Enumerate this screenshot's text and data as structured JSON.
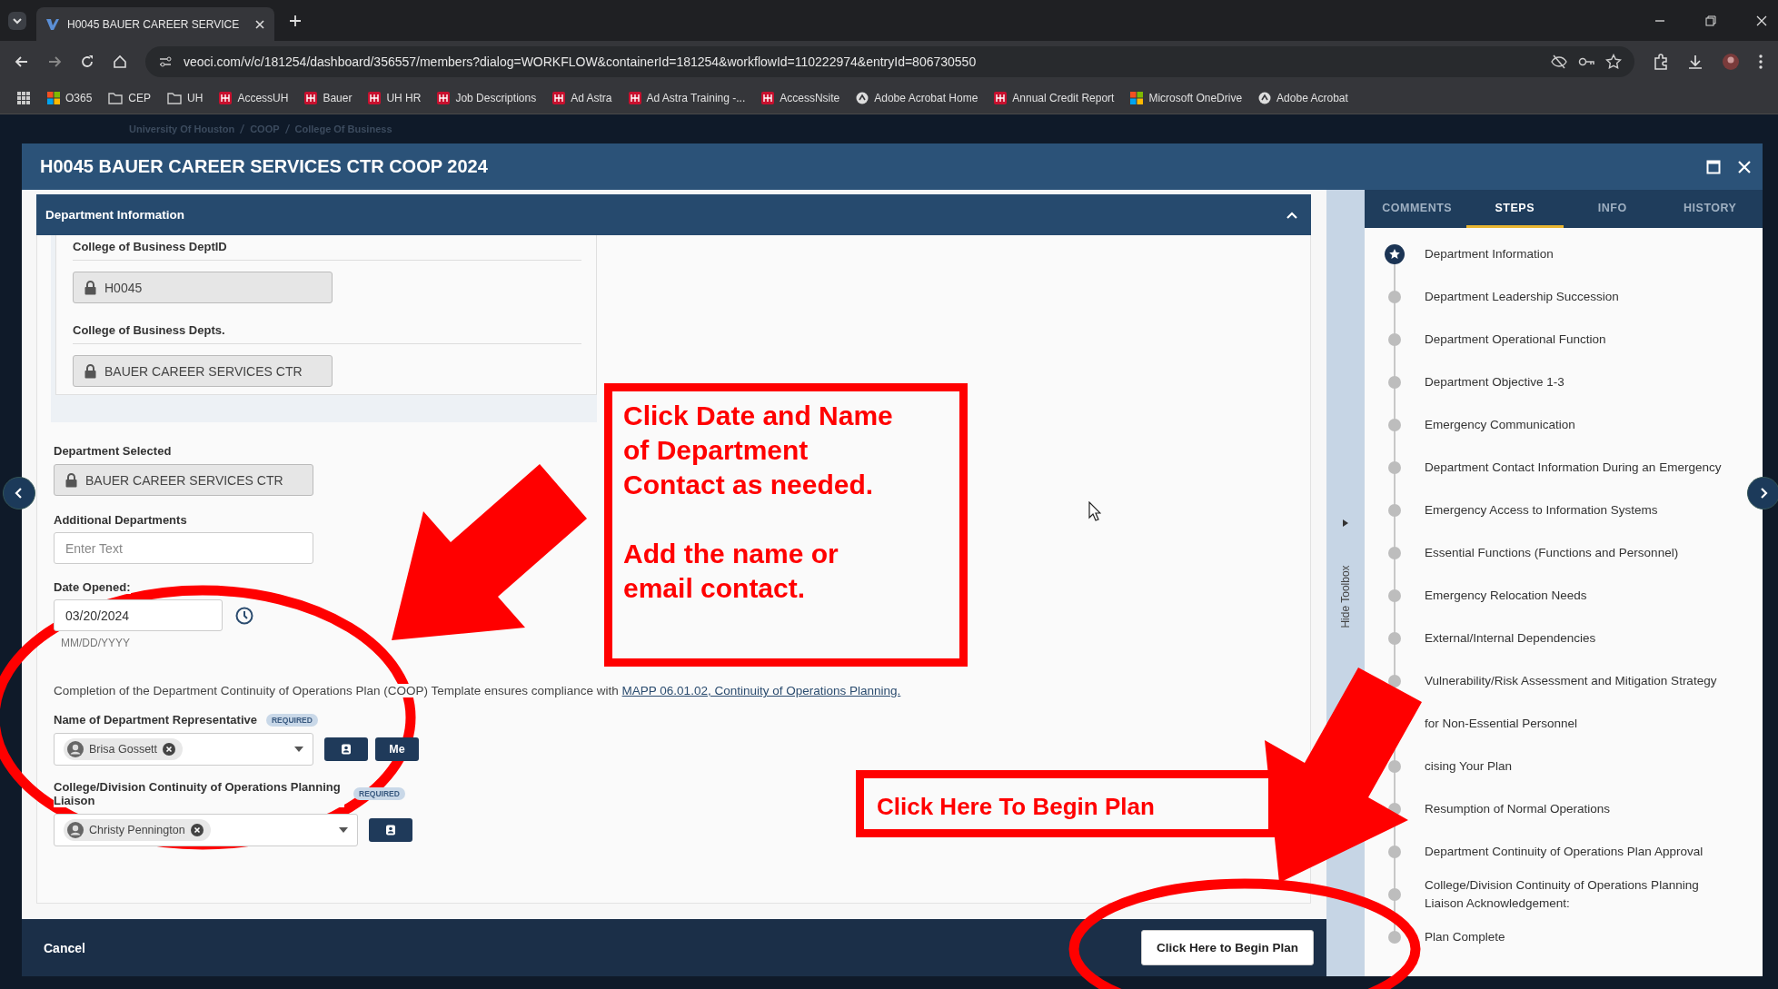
{
  "browser": {
    "tab_title": "H0045 BAUER CAREER SERVICE",
    "url": "veoci.com/v/c/181254/dashboard/356557/members?dialog=WORKFLOW&containerId=181254&workflowId=110222974&entryId=806730550",
    "bookmarks": [
      {
        "label": "O365",
        "kind": "tiles"
      },
      {
        "label": "CEP",
        "kind": "folder"
      },
      {
        "label": "UH",
        "kind": "folder"
      },
      {
        "label": "AccessUH",
        "kind": "logo"
      },
      {
        "label": "Bauer",
        "kind": "logo"
      },
      {
        "label": "UH HR",
        "kind": "logo"
      },
      {
        "label": "Job Descriptions",
        "kind": "logo"
      },
      {
        "label": "Ad Astra",
        "kind": "logo"
      },
      {
        "label": "Ad Astra Training -...",
        "kind": "logo"
      },
      {
        "label": "AccessNsite",
        "kind": "logo"
      },
      {
        "label": "Adobe Acrobat Home",
        "kind": "globe"
      },
      {
        "label": "Annual Credit Report",
        "kind": "logo"
      },
      {
        "label": "Microsoft OneDrive",
        "kind": "tiles"
      },
      {
        "label": "Adobe Acrobat",
        "kind": "globe"
      }
    ]
  },
  "app": {
    "breadcrumb": [
      "University Of Houston",
      "COOP",
      "College Of Business"
    ]
  },
  "dialog": {
    "title": "H0045 BAUER CAREER SERVICES CTR COOP 2024",
    "section": {
      "title": "Department Information",
      "expanded": true
    },
    "locked_group": [
      {
        "label": "College of Business DeptID",
        "value": "H0045"
      },
      {
        "label": "College of Business Depts.",
        "value": "BAUER CAREER SERVICES CTR"
      }
    ],
    "department_selected": {
      "label": "Department Selected",
      "value": "BAUER CAREER SERVICES CTR"
    },
    "additional_departments": {
      "label": "Additional Departments",
      "placeholder": "Enter Text"
    },
    "date_opened": {
      "label": "Date Opened:",
      "value": "03/20/2024",
      "hint": "MM/DD/YYYY"
    },
    "notice": {
      "text": "Completion of the Department Continuity of Operations Plan (COOP) Template ensures compliance with",
      "link": "MAPP 06.01.02, Continuity of Operations Planning."
    },
    "people_fields": [
      {
        "label": "Name of Department Representative",
        "badge": "REQUIRED",
        "person": "Brisa Gossett",
        "me_button": "Me"
      },
      {
        "label": "College/Division Continuity of Operations Planning Liaison",
        "badge": "REQUIRED",
        "person": "Christy Pennington"
      }
    ],
    "footer": {
      "cancel": "Cancel",
      "primary": "Click Here to Begin Plan"
    }
  },
  "toolbox_toggle": "Hide Toolbox",
  "side_panel": {
    "tabs": [
      {
        "label": "COMMENTS",
        "selected": false
      },
      {
        "label": "STEPS",
        "selected": true
      },
      {
        "label": "INFO",
        "selected": false
      },
      {
        "label": "HISTORY",
        "selected": false
      }
    ],
    "steps": [
      {
        "label": "Department Information",
        "current": true
      },
      {
        "label": "Department Leadership Succession",
        "current": false
      },
      {
        "label": "Department Operational Function",
        "current": false
      },
      {
        "label": "Department Objective 1-3",
        "current": false
      },
      {
        "label": "Emergency Communication",
        "current": false
      },
      {
        "label": "Department Contact Information During an Emergency",
        "current": false
      },
      {
        "label": "Emergency Access to Information Systems",
        "current": false
      },
      {
        "label": "Essential Functions (Functions and Personnel)",
        "current": false
      },
      {
        "label": "Emergency Relocation Needs",
        "current": false
      },
      {
        "label": "External/Internal Dependencies",
        "current": false
      },
      {
        "label": "Vulnerability/Risk Assessment and Mitigation Strategy",
        "current": false
      },
      {
        "label": "for Non-Essential Personnel",
        "current": false
      },
      {
        "label": "cising Your Plan",
        "current": false
      },
      {
        "label": "Resumption of Normal Operations",
        "current": false
      },
      {
        "label": "Department Continuity of Operations Plan Approval",
        "current": false
      },
      {
        "label": "College/Division Continuity of Operations Planning Liaison Acknowledgement:",
        "current": false
      },
      {
        "label": "Plan Complete",
        "current": false
      }
    ]
  },
  "annotations": [
    {
      "kind": "callout",
      "text": "Click Date and Name\nof Department\nContact as needed.\n\nAdd the name or\nemail contact."
    },
    {
      "kind": "callout",
      "text": "Click Here To Begin Plan"
    },
    {
      "kind": "arrow"
    },
    {
      "kind": "arrow"
    },
    {
      "kind": "ellipse"
    },
    {
      "kind": "ellipse"
    }
  ]
}
